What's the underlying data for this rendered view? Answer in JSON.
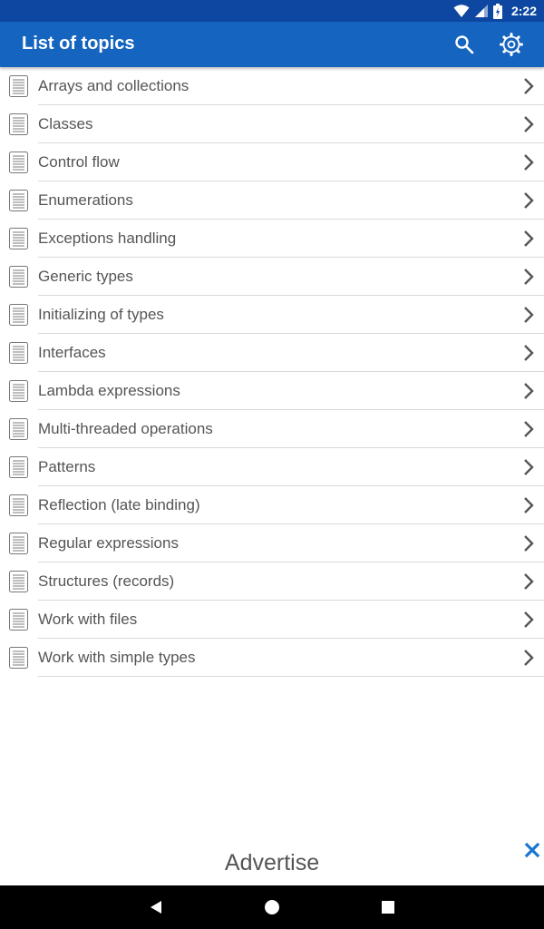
{
  "status_bar": {
    "time": "2:22",
    "icons": [
      "wifi-icon",
      "signal-icon",
      "battery-icon"
    ]
  },
  "app_bar": {
    "title": "List of topics",
    "actions": [
      "search-icon",
      "settings-icon"
    ]
  },
  "topics": [
    {
      "label": "Arrays and collections"
    },
    {
      "label": "Classes"
    },
    {
      "label": "Control flow"
    },
    {
      "label": "Enumerations"
    },
    {
      "label": "Exceptions handling"
    },
    {
      "label": "Generic types"
    },
    {
      "label": "Initializing of types"
    },
    {
      "label": "Interfaces"
    },
    {
      "label": "Lambda expressions"
    },
    {
      "label": "Multi-threaded operations"
    },
    {
      "label": "Patterns"
    },
    {
      "label": "Reflection (late binding)"
    },
    {
      "label": "Regular expressions"
    },
    {
      "label": "Structures (records)"
    },
    {
      "label": "Work with files"
    },
    {
      "label": "Work with simple types"
    }
  ],
  "ad": {
    "label": "Advertise"
  },
  "nav_bar": {
    "buttons": [
      "back-icon",
      "home-icon",
      "recents-icon"
    ]
  },
  "colors": {
    "status_bar": "#0d47a1",
    "app_bar": "#1565c0",
    "ad_close": "#1976d2"
  }
}
